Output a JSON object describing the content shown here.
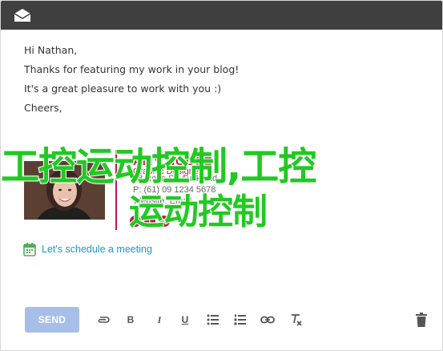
{
  "email": {
    "greeting": "Hi Nathan,",
    "line1": "Thanks for featuring my work in your blog!",
    "line2": "It's a great pleasure to work with you :)",
    "closing": "Cheers,"
  },
  "signature": {
    "name": "AMY HOUSE",
    "title": "Graphic Designer",
    "phone": "P: (61) 09 1234 5678",
    "address": "88 Rose St, Auckland",
    "website": "Website: Email",
    "socials": [
      "f",
      "t",
      "in"
    ]
  },
  "watermark": {
    "line1": "工控运动控制,工控",
    "line2": "运动控制"
  },
  "schedule": {
    "link_text": "Let's schedule a meeting"
  },
  "toolbar": {
    "send_label": "SEND",
    "tools": [
      "attach-icon",
      "bold-icon",
      "italic-icon",
      "underline-icon",
      "bullet-list-icon",
      "numbered-list-icon",
      "link-icon",
      "clear-format-icon"
    ],
    "bold_glyph": "B",
    "italic_glyph": "I",
    "underline_glyph": "U"
  },
  "colors": {
    "titlebar": "#404040",
    "accent": "#c0174b",
    "link": "#2196c9",
    "send_button": "#a7bfe8",
    "watermark": "#22c922"
  }
}
